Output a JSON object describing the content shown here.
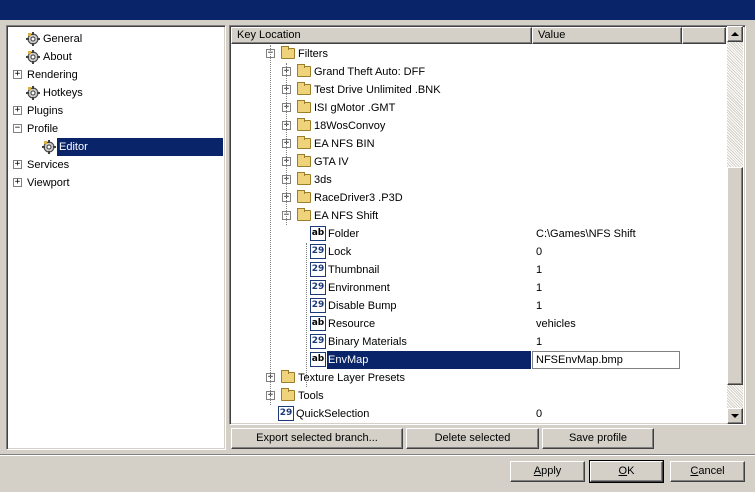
{
  "nav": {
    "items": [
      {
        "label": "General",
        "level": 1,
        "expander": "",
        "icon": "gear-icon"
      },
      {
        "label": "About",
        "level": 1,
        "expander": "",
        "icon": "gear-icon"
      },
      {
        "label": "Rendering",
        "level": 0,
        "expander": "+"
      },
      {
        "label": "Hotkeys",
        "level": 1,
        "expander": "",
        "icon": "gear-icon"
      },
      {
        "label": "Plugins",
        "level": 0,
        "expander": "+"
      },
      {
        "label": "Profile",
        "level": 0,
        "expander": "−"
      },
      {
        "label": "Editor",
        "level": 2,
        "expander": "",
        "icon": "gear-icon",
        "selected": true
      },
      {
        "label": "Services",
        "level": 0,
        "expander": "+"
      },
      {
        "label": "Viewport",
        "level": 0,
        "expander": "+"
      }
    ]
  },
  "grid": {
    "columns": [
      "Key Location",
      "Value"
    ],
    "rows": [
      {
        "label": "Filters",
        "icon": "folder-icon",
        "expander": "−",
        "indent": 2,
        "value": ""
      },
      {
        "label": "Grand Theft Auto: DFF",
        "icon": "folder-icon",
        "expander": "+",
        "indent": 3,
        "value": ""
      },
      {
        "label": "Test Drive Unlimited .BNK",
        "icon": "folder-icon",
        "expander": "+",
        "indent": 3,
        "value": ""
      },
      {
        "label": "ISI gMotor .GMT",
        "icon": "folder-icon",
        "expander": "+",
        "indent": 3,
        "value": ""
      },
      {
        "label": "18WosConvoy",
        "icon": "folder-icon",
        "expander": "+",
        "indent": 3,
        "value": ""
      },
      {
        "label": "EA NFS BIN",
        "icon": "folder-icon",
        "expander": "+",
        "indent": 3,
        "value": ""
      },
      {
        "label": "GTA IV",
        "icon": "folder-icon",
        "expander": "+",
        "indent": 3,
        "value": ""
      },
      {
        "label": "3ds",
        "icon": "folder-icon",
        "expander": "+",
        "indent": 3,
        "value": ""
      },
      {
        "label": "RaceDriver3 .P3D",
        "icon": "folder-icon",
        "expander": "+",
        "indent": 3,
        "value": ""
      },
      {
        "label": "EA NFS Shift",
        "icon": "folder-icon",
        "expander": "−",
        "indent": 3,
        "value": ""
      },
      {
        "label": "Folder",
        "icon": "string-value-icon",
        "icon_text": "ab",
        "indent": 4,
        "value": "C:\\Games\\NFS Shift"
      },
      {
        "label": "Lock",
        "icon": "number-value-icon",
        "icon_text": "29",
        "indent": 4,
        "value": "0"
      },
      {
        "label": "Thumbnail",
        "icon": "number-value-icon",
        "icon_text": "29",
        "indent": 4,
        "value": "1"
      },
      {
        "label": "Environment",
        "icon": "number-value-icon",
        "icon_text": "29",
        "indent": 4,
        "value": "1"
      },
      {
        "label": "Disable Bump",
        "icon": "number-value-icon",
        "icon_text": "29",
        "indent": 4,
        "value": "1"
      },
      {
        "label": "Resource",
        "icon": "string-value-icon",
        "icon_text": "ab",
        "indent": 4,
        "value": "vehicles"
      },
      {
        "label": "Binary Materials",
        "icon": "number-value-icon",
        "icon_text": "29",
        "indent": 4,
        "value": "1"
      },
      {
        "label": "EnvMap",
        "icon": "string-value-icon",
        "icon_text": "ab",
        "indent": 4,
        "value": "NFSEnvMap.bmp",
        "selected": true,
        "editing": true
      },
      {
        "label": "Texture Layer Presets",
        "icon": "folder-icon",
        "expander": "+",
        "indent": 2,
        "value": ""
      },
      {
        "label": "Tools",
        "icon": "folder-icon",
        "expander": "+",
        "indent": 2,
        "value": ""
      },
      {
        "label": "QuickSelection",
        "icon": "number-value-icon",
        "icon_text": "29",
        "indent": 1,
        "value": "0"
      }
    ]
  },
  "grid_buttons": {
    "export": "Export selected branch...",
    "delete": "Delete selected",
    "save": "Save profile"
  },
  "dialog_buttons": {
    "apply_pre": "",
    "apply_u": "A",
    "apply_post": "pply",
    "ok_pre": "",
    "ok_u": "O",
    "ok_post": "K",
    "cancel_pre": "",
    "cancel_u": "C",
    "cancel_post": "ancel"
  },
  "colors": {
    "title_bar": "#0a246a",
    "selection": "#0a246a",
    "face": "#d4d0c8"
  }
}
